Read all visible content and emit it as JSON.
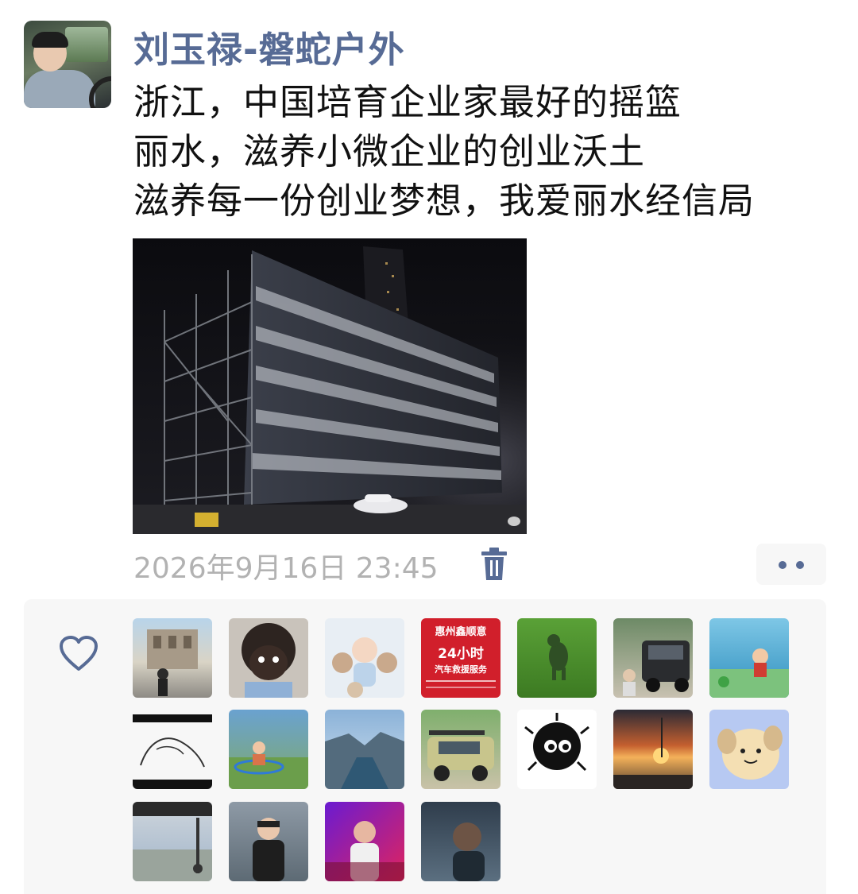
{
  "post": {
    "author": "刘玉禄-磐蛇户外",
    "lines": [
      "浙江，中国培育企业家最好的摇篮",
      "丽水，滋养小微企业的创业沃土",
      "滋养每一份创业梦想，我爱丽水经信局"
    ],
    "timestamp": "2026年9月16日 23:45"
  },
  "icons": {
    "delete": "trash-icon",
    "more": "more-dots-icon",
    "like": "heart-outline-icon"
  },
  "colors": {
    "author_name": "#576b95",
    "timestamp": "#b2b2b2",
    "likes_background": "#f7f7f7"
  },
  "likes": {
    "count_avatars": 18,
    "avatar_descriptions": [
      "landmark-ruins",
      "dark-face-child",
      "baby-with-teddy-bears",
      "rescue-ad",
      "green-dinosaur-on-grass",
      "offroad-vehicle",
      "cartoon-boy-on-beach",
      "sketch-drawing",
      "child-on-swing",
      "river-canyon",
      "rally-suv",
      "soot-sprite",
      "sunset-sea",
      "cartoon-dog",
      "car-window-view",
      "man-with-glasses",
      "neon-portrait",
      "man-looking-up"
    ],
    "rescue_ad": {
      "line1": "惠州鑫顺意",
      "line2": "24小时",
      "line3": "汽车救援服务"
    }
  }
}
